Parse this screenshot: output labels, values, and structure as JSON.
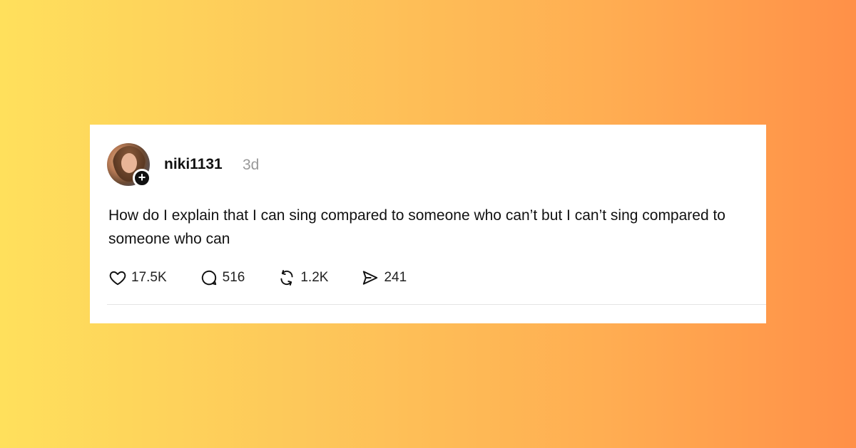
{
  "post": {
    "username": "niki1131",
    "time": "3d",
    "text": "How do I explain that I can sing compared to someone who can’t but I can’t sing compared to someone who can",
    "follow_symbol": "+"
  },
  "actions": {
    "likes": "17.5K",
    "replies": "516",
    "reposts": "1.2K",
    "shares": "241"
  },
  "colors": {
    "text": "#111111",
    "muted": "#999999",
    "background_gradient": [
      "#ffe05c",
      "#ff9048"
    ]
  },
  "icons": [
    "heart-icon",
    "comment-icon",
    "repost-icon",
    "share-icon",
    "plus-icon"
  ]
}
